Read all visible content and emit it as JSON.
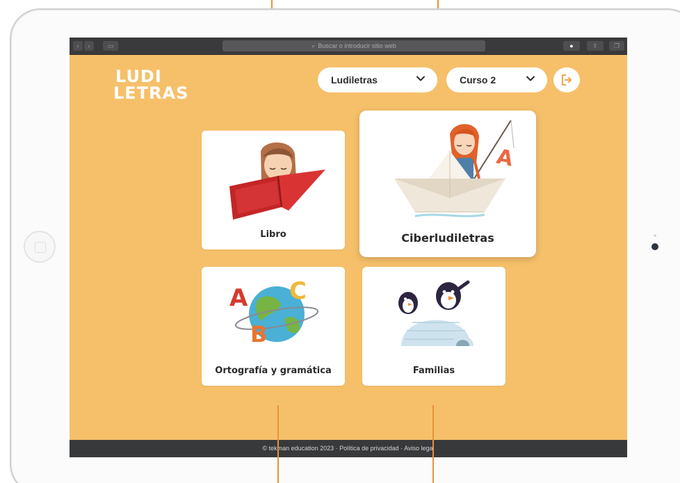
{
  "browser": {
    "search_placeholder": "Buscar o introducir sitio web"
  },
  "app": {
    "logo_line1": "LUDI",
    "logo_line2": "LETRAS",
    "series_select": "Ludiletras",
    "course_select": "Curso 2"
  },
  "cards": [
    {
      "title": "Libro"
    },
    {
      "title": "Ciberludiletras"
    },
    {
      "title": "Ortografía y gramática"
    },
    {
      "title": "Familias"
    }
  ],
  "footer": {
    "text": "© tekman education 2023 · Política de privacidad · Aviso legal"
  },
  "colors": {
    "background": "#f6c06a",
    "callout": "#e8923a",
    "footer": "#37393b"
  },
  "icons": [
    "chevron-down-icon",
    "logout-icon",
    "search-icon",
    "download-icon",
    "share-icon",
    "tabs-icon"
  ]
}
